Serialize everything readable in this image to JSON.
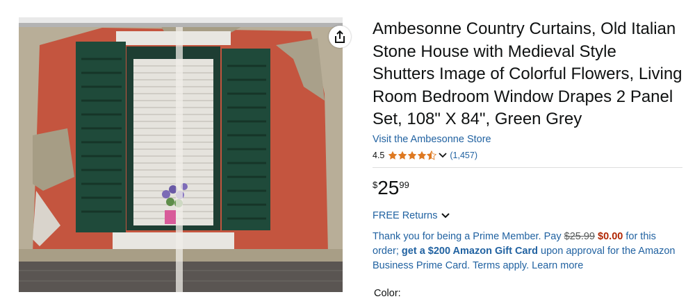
{
  "product": {
    "title": "Ambesonne Country Curtains, Old Italian Stone House with Medieval Style Shutters Image of Colorful Flowers, Living Room Bedroom Window Drapes 2 Panel Set, 108\" X 84\", Green Grey",
    "store_link": "Visit the Ambesonne Store",
    "rating": "4.5",
    "rating_count": "(1,457)",
    "price_symbol": "$",
    "price_whole": "25",
    "price_fraction": "99",
    "returns": "FREE Returns",
    "prime_message": {
      "part1": "Thank you for being a Prime Member. Pay ",
      "old_price": "$25.99",
      "new_price": "$0.00",
      "part2": " for this order; ",
      "gift_card": "get a $200 Amazon Gift Card",
      "part3": " upon approval for the Amazon Business Prime Card. Terms apply. Learn more"
    },
    "color_label": "Color:"
  },
  "icons": {
    "share": "share-icon",
    "star": "star-icon",
    "chevron": "chevron-down-icon"
  },
  "colors": {
    "link": "#2162a1",
    "price_red": "#b12704",
    "star": "#de7921",
    "shutter_green": "#1f4a3a",
    "wall_red": "#c4553f"
  }
}
